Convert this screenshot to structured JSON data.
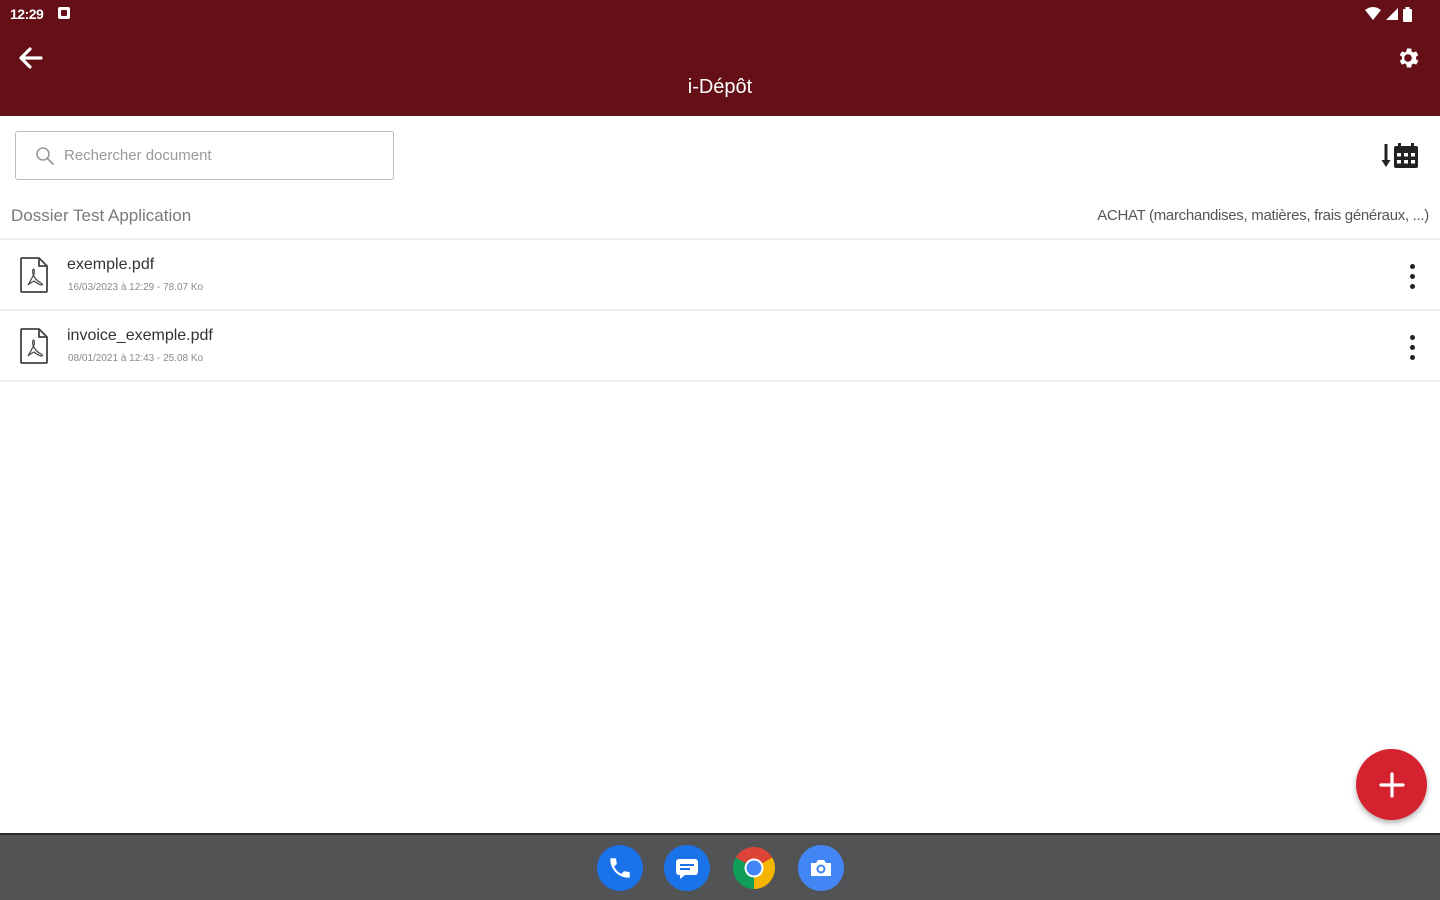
{
  "status_bar": {
    "time": "12:29"
  },
  "header": {
    "title": "i-Dépôt"
  },
  "search": {
    "placeholder": "Rechercher document",
    "value": ""
  },
  "context": {
    "folder": "Dossier Test Application",
    "category": "ACHAT (marchandises, matières, frais généraux, ...)"
  },
  "documents": [
    {
      "name": "exemple.pdf",
      "meta": "16/03/2023 à 12:29 - 78.07 Ko"
    },
    {
      "name": "invoice_exemple.pdf",
      "meta": "08/01/2021 à 12:43 - 25.08 Ko"
    }
  ],
  "colors": {
    "app_bar": "#650f17",
    "fab": "#d4232f",
    "taskbar": "#525355"
  },
  "icons": {
    "back": "arrow-left-icon",
    "settings": "gear-icon",
    "search": "search-icon",
    "sort": "sort-by-date-icon",
    "document": "pdf-file-icon",
    "menu": "more-vertical-icon",
    "add": "plus-icon",
    "dock": [
      "phone-icon",
      "messages-icon",
      "chrome-icon",
      "camera-icon"
    ]
  }
}
